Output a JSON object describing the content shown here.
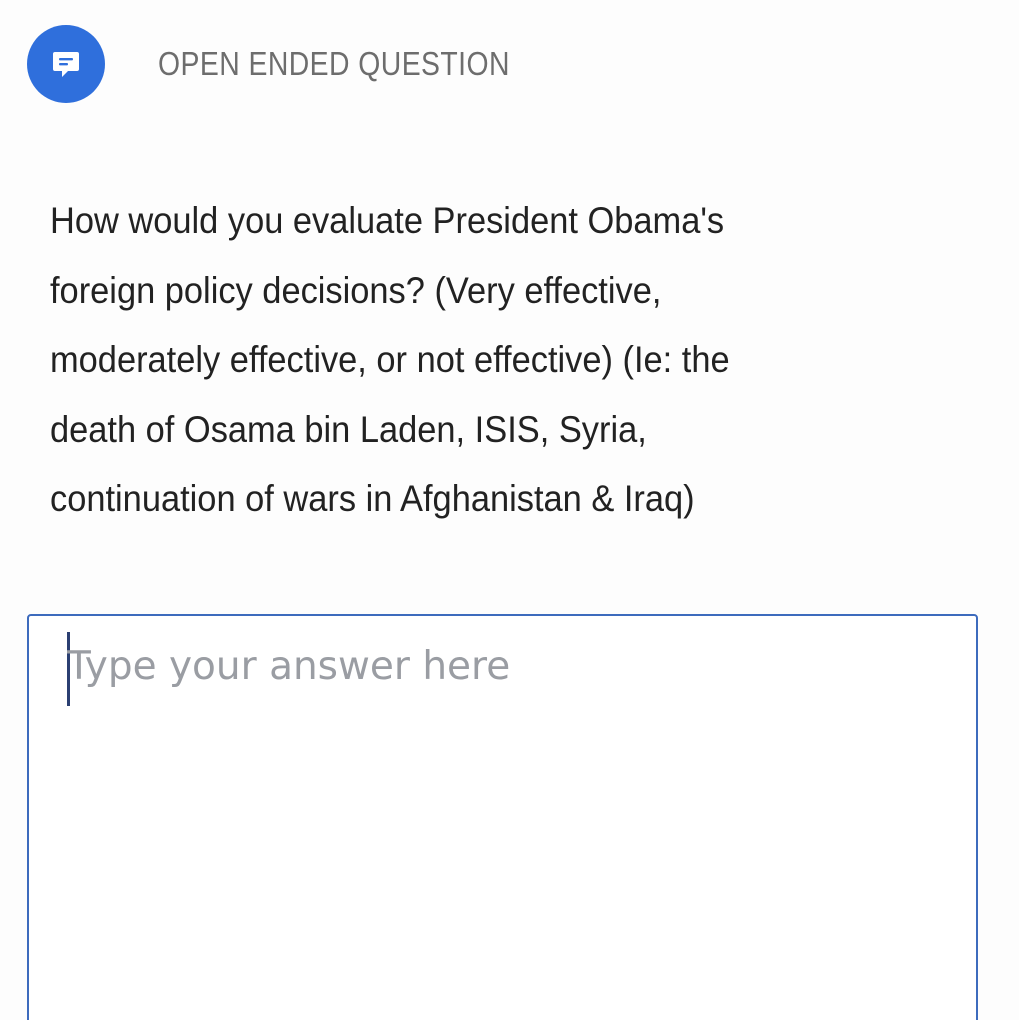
{
  "header": {
    "icon": "chat-bubble-icon",
    "question_type": "OPEN ENDED QUESTION"
  },
  "question": {
    "lines": [
      "How would you evaluate President Obama's",
      "foreign policy decisions? (Very effective,",
      "moderately effective, or not effective) (Ie: the",
      "death of Osama bin Laden, ISIS, Syria,",
      "continuation of wars in Afghanistan & Iraq)"
    ]
  },
  "answer": {
    "placeholder": "Type your answer here",
    "value": ""
  },
  "colors": {
    "accent": "#2f6fdc",
    "box_border": "#3d6bbd",
    "placeholder": "#9a9da3",
    "text": "#222222",
    "label": "#6d6d6d"
  }
}
